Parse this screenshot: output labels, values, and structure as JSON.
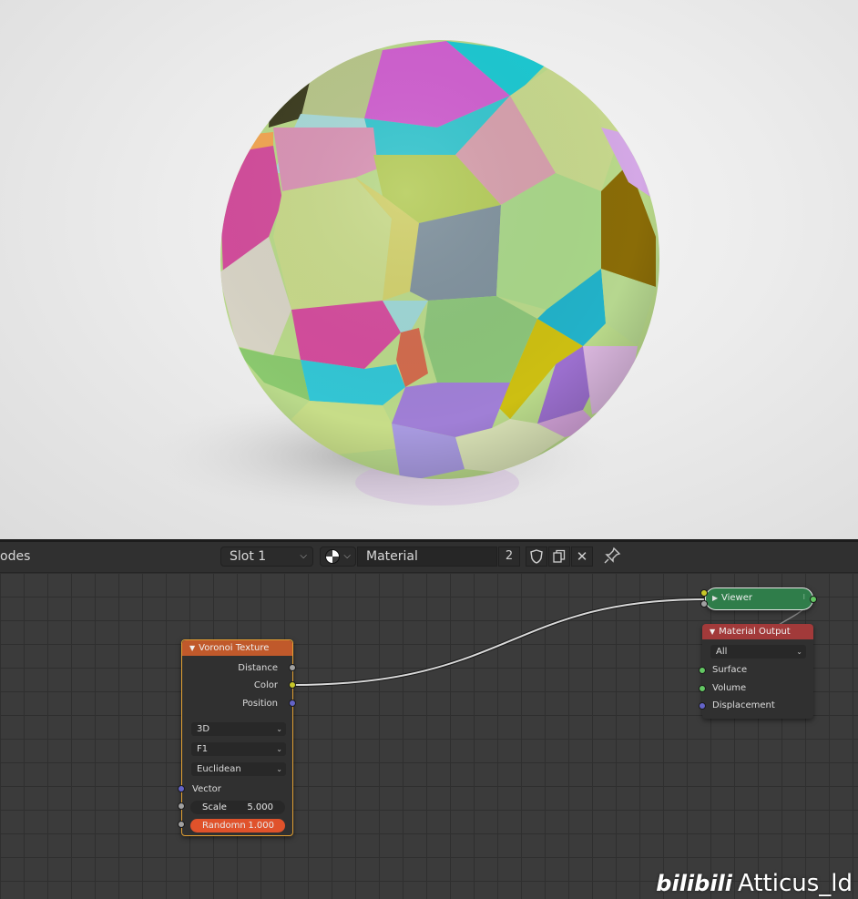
{
  "header": {
    "editor_label": "odes",
    "slot": "Slot 1",
    "material_name": "Material",
    "user_count": "2",
    "icons": [
      "sphere-preview-icon",
      "shield-icon",
      "copy-icon",
      "close-icon",
      "pin-icon"
    ]
  },
  "nodes": {
    "voronoi": {
      "title": "Voronoi Texture",
      "outputs": [
        "Distance",
        "Color",
        "Position"
      ],
      "dimensions": "3D",
      "feature": "F1",
      "distance_metric": "Euclidean",
      "inputs": {
        "vector": "Vector",
        "scale_label": "Scale",
        "scale_value": "5.000",
        "randomness_label": "Randomn",
        "randomness_value": "1.000"
      },
      "header_color": "#c0592b"
    },
    "viewer": {
      "title": "Viewer",
      "color": "#2f7d4a"
    },
    "material_output": {
      "title": "Material Output",
      "target": "All",
      "inputs": [
        "Surface",
        "Volume",
        "Displacement"
      ],
      "header_color": "#a23a3a"
    }
  },
  "watermark": {
    "logo": "bilibili",
    "user": "Atticus_ld"
  },
  "colors": {
    "socket_color": "#c7c729",
    "socket_float": "#a1a1a1",
    "socket_vector": "#6363c7",
    "socket_shader": "#63c763"
  }
}
